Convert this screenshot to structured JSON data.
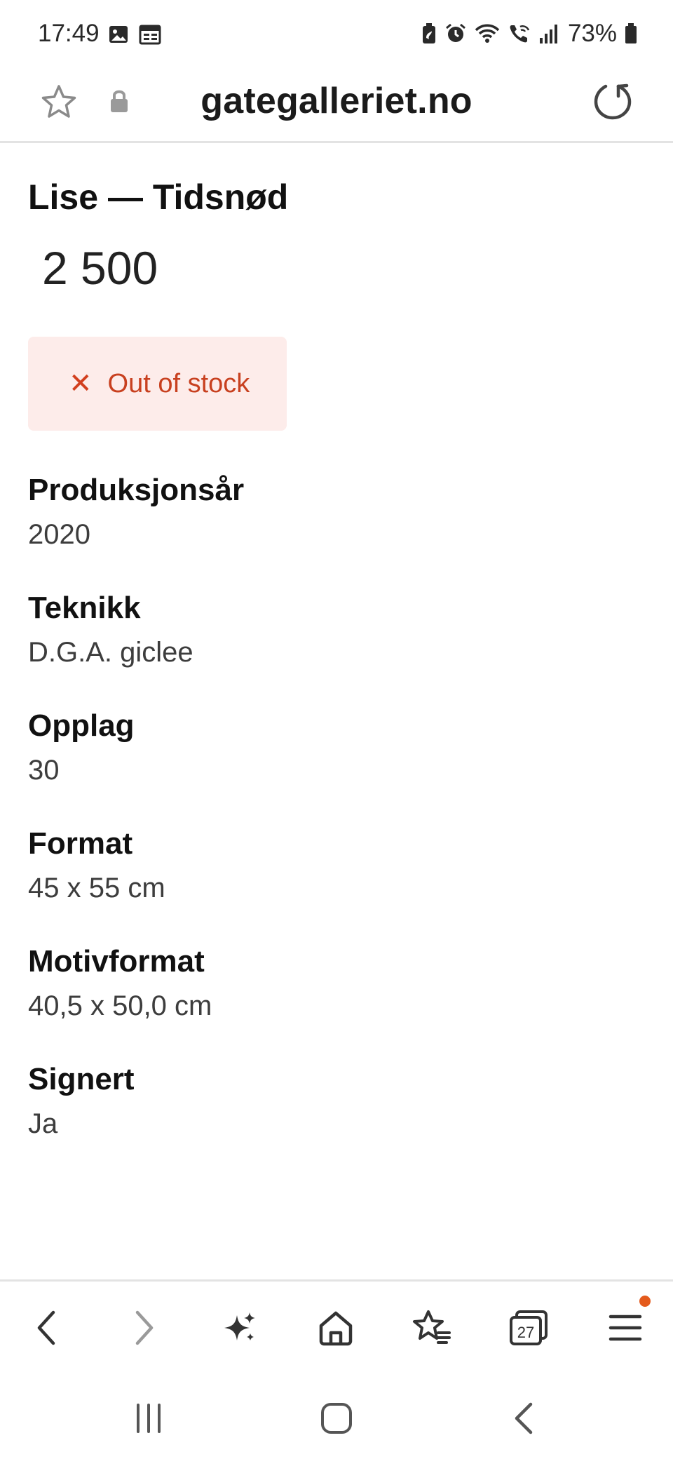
{
  "status_bar": {
    "time": "17:49",
    "battery": "73%",
    "left_icons": [
      "gallery-icon",
      "calendar-icon"
    ],
    "right_icons": [
      "battery-saver-icon",
      "alarm-icon",
      "wifi-icon",
      "wifi-call-icon",
      "signal-icon",
      "battery-icon"
    ]
  },
  "url_bar": {
    "url": "gategalleriet.no"
  },
  "product": {
    "title": "Lise — Tidsnød",
    "price": "2 500",
    "stock_status": "Out of stock",
    "attributes": [
      {
        "label": "Produksjonsår",
        "value": "2020"
      },
      {
        "label": "Teknikk",
        "value": "D.G.A. giclee"
      },
      {
        "label": "Opplag",
        "value": "30"
      },
      {
        "label": "Format",
        "value": "45 x 55 cm"
      },
      {
        "label": "Motivformat",
        "value": "40,5 x 50,0 cm"
      },
      {
        "label": "Signert",
        "value": "Ja"
      }
    ]
  },
  "browser_bar": {
    "tabs_count": "27",
    "buttons": [
      "back-icon",
      "forward-icon",
      "ai-sparkle-icon",
      "home-icon",
      "bookmarks-icon",
      "tabs-icon",
      "menu-icon"
    ]
  },
  "colors": {
    "stock_bg": "#fdecea",
    "stock_text": "#c8401f",
    "notification_dot": "#e45a1c"
  }
}
